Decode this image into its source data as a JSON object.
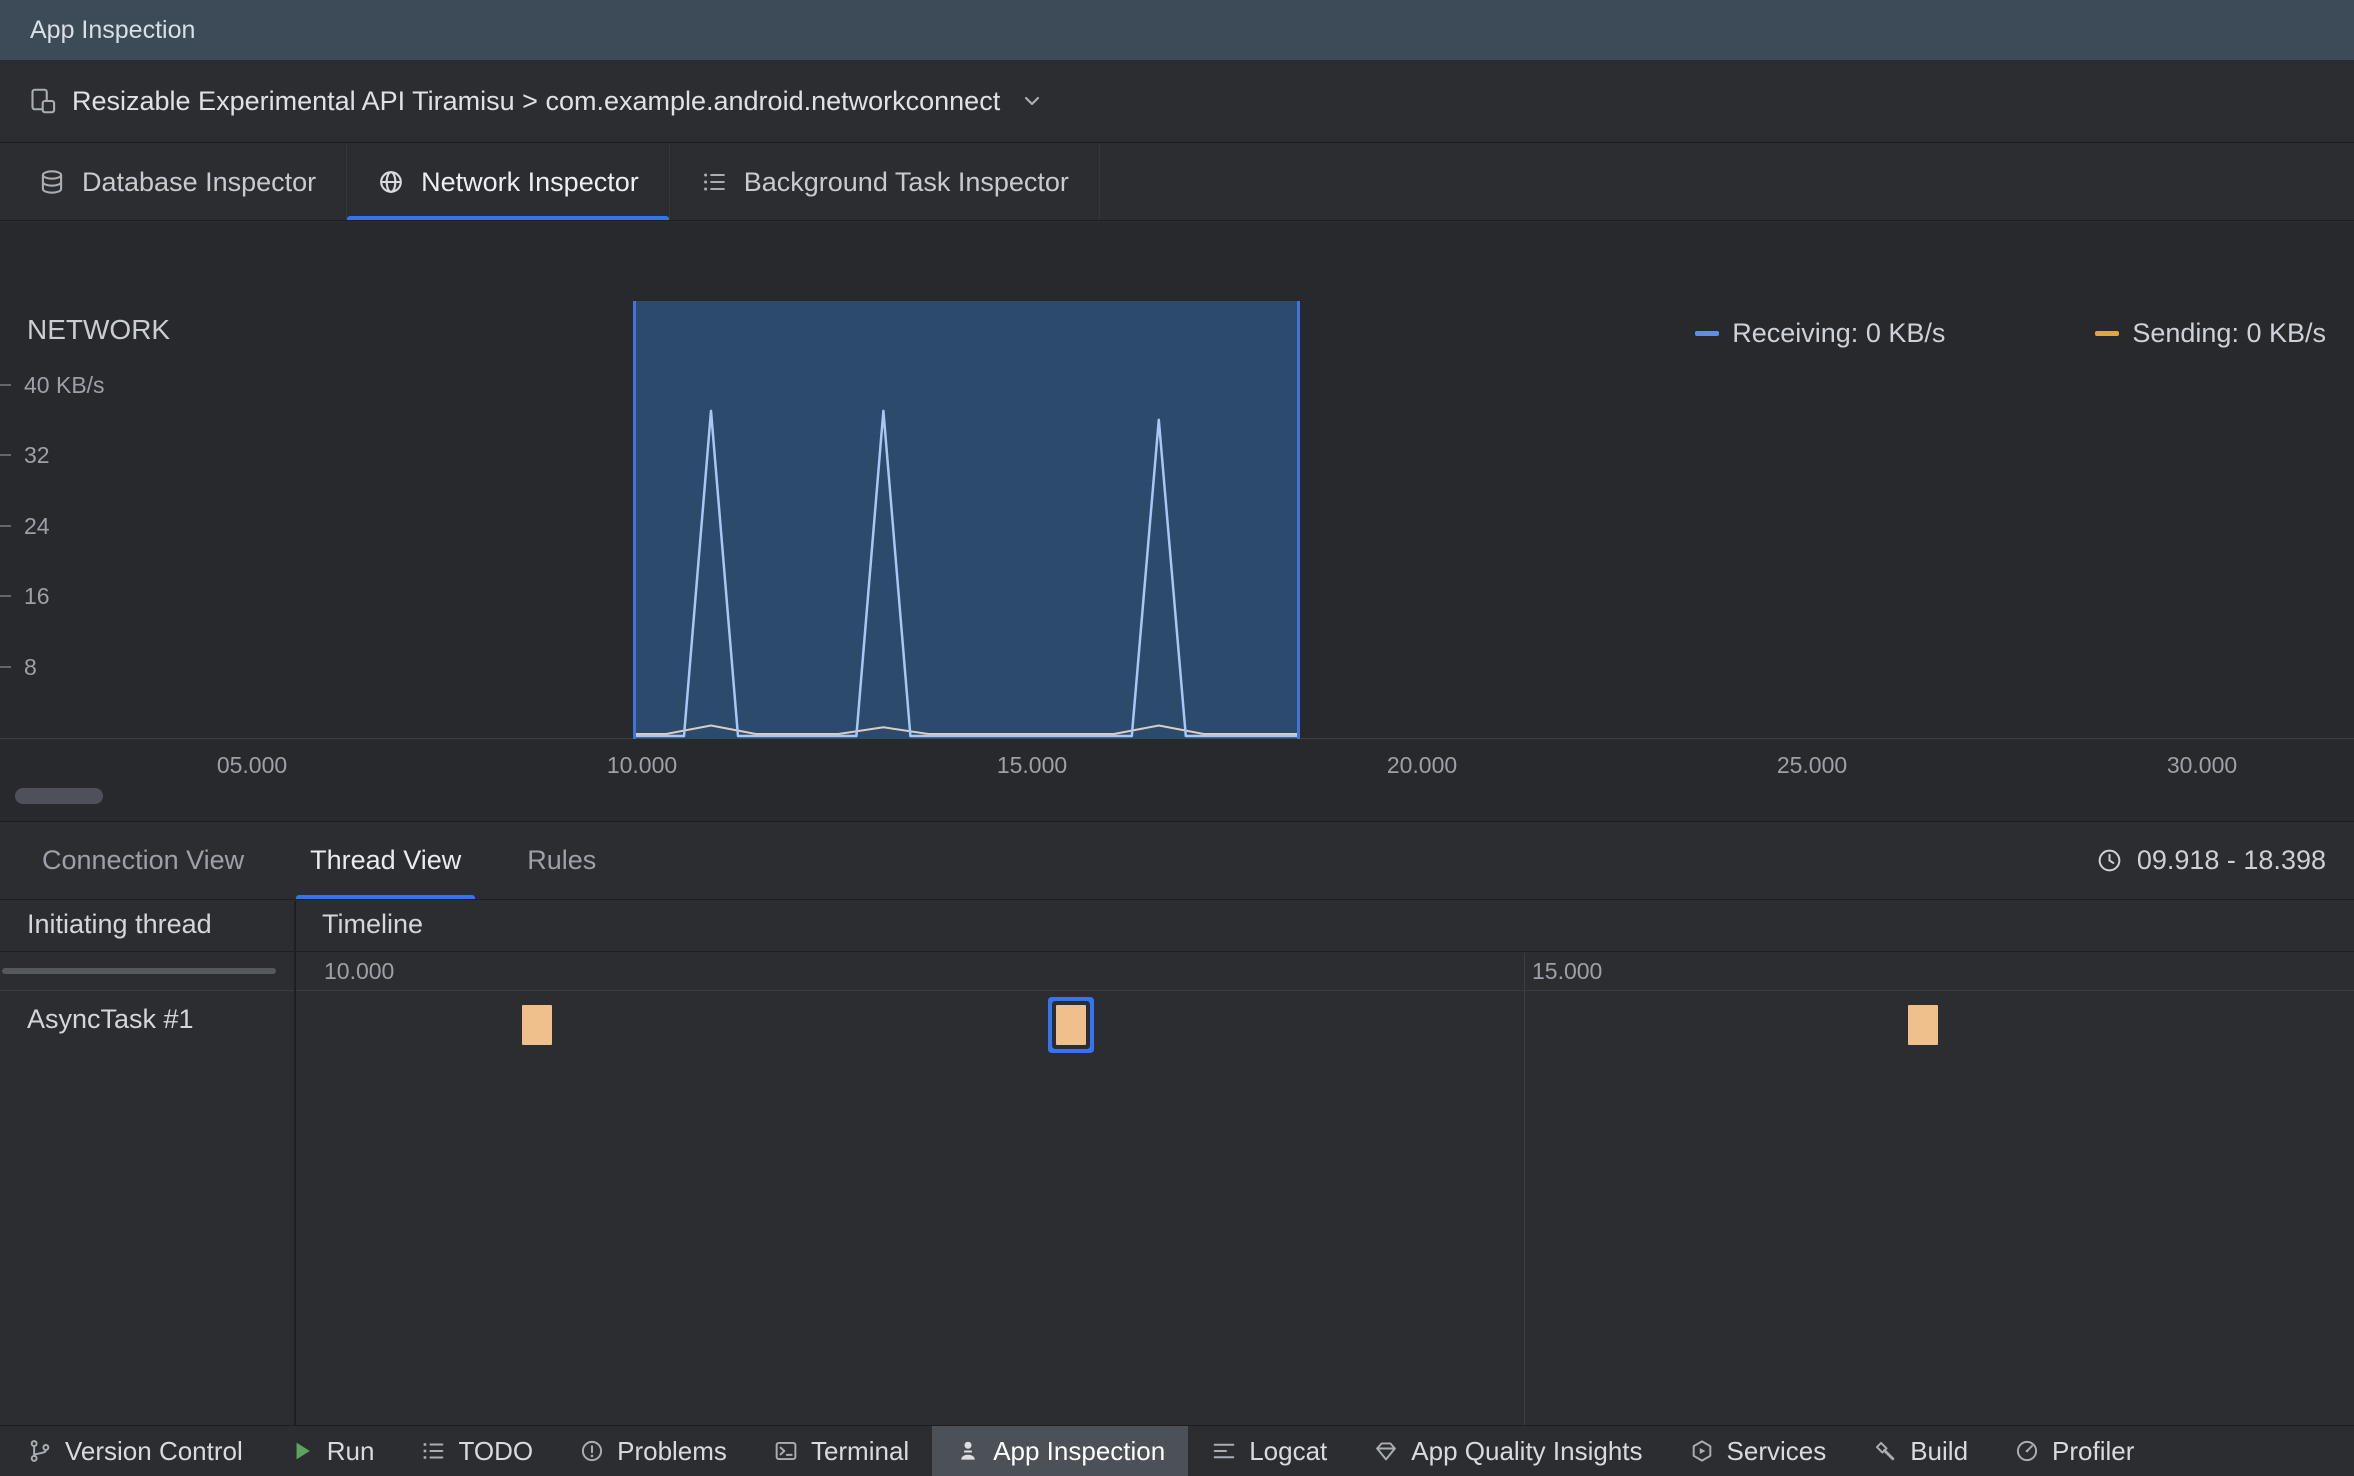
{
  "titlebar": {
    "title": "App Inspection"
  },
  "device_bar": {
    "label": "Resizable Experimental API Tiramisu > com.example.android.networkconnect"
  },
  "inspector_tabs": [
    {
      "label": "Database Inspector",
      "icon": "database-icon",
      "selected": false
    },
    {
      "label": "Network Inspector",
      "icon": "globe-icon",
      "selected": true
    },
    {
      "label": "Background Task Inspector",
      "icon": "list-icon",
      "selected": false
    }
  ],
  "chart_data": {
    "type": "area",
    "title": "NETWORK",
    "y_axis": {
      "unit": "KB/s",
      "ticks": [
        "40 KB/s",
        "32",
        "24",
        "16",
        "8"
      ],
      "tick_values": [
        40,
        32,
        24,
        16,
        8
      ],
      "range": [
        0,
        48
      ]
    },
    "x_axis": {
      "unit": "s",
      "ticks": [
        "05.000",
        "10.000",
        "15.000",
        "20.000",
        "25.000",
        "30.000"
      ],
      "tick_values": [
        5,
        10,
        15,
        20,
        25,
        30
      ]
    },
    "legend": [
      {
        "label": "Receiving: 0 KB/s",
        "color": "#5E8FE8"
      },
      {
        "label": "Sending: 0 KB/s",
        "color": "#E8A33D"
      }
    ],
    "selection": {
      "start_s": 9.918,
      "end_s": 18.398
    },
    "series": [
      {
        "name": "Receiving",
        "color": "#A9C7F2",
        "peaks": [
          {
            "t": 10.88,
            "value": 37
          },
          {
            "t": 13.09,
            "value": 37
          },
          {
            "t": 16.62,
            "value": 36
          }
        ]
      },
      {
        "name": "Sending",
        "color": "#D8CFC2",
        "peaks": [
          {
            "t": 10.88,
            "value": 1.3
          },
          {
            "t": 13.09,
            "value": 1.1
          },
          {
            "t": 16.62,
            "value": 1.3
          }
        ]
      }
    ]
  },
  "detail_tabs": [
    {
      "label": "Connection View",
      "selected": false
    },
    {
      "label": "Thread View",
      "selected": true
    },
    {
      "label": "Rules",
      "selected": false
    }
  ],
  "time_range": {
    "icon": "clock-icon",
    "label": "09.918 - 18.398"
  },
  "thread_table": {
    "columns": [
      "Initiating thread",
      "Timeline"
    ],
    "ticks": [
      {
        "label": "10.000",
        "t": 10,
        "grid": false
      },
      {
        "label": "15.000",
        "t": 15,
        "grid": true
      }
    ],
    "rows": [
      {
        "thread": "AsyncTask #1",
        "events": [
          {
            "t": 10.88,
            "selected": false
          },
          {
            "t": 13.09,
            "selected": true
          },
          {
            "t": 16.62,
            "selected": false
          }
        ]
      }
    ]
  },
  "bottom_bar": [
    {
      "label": "Version Control",
      "icon": "version-control-icon",
      "selected": false
    },
    {
      "label": "Run",
      "icon": "run-icon",
      "selected": false
    },
    {
      "label": "TODO",
      "icon": "todo-icon",
      "selected": false
    },
    {
      "label": "Problems",
      "icon": "problems-icon",
      "selected": false
    },
    {
      "label": "Terminal",
      "icon": "terminal-icon",
      "selected": false
    },
    {
      "label": "App Inspection",
      "icon": "app-inspection-icon",
      "selected": true
    },
    {
      "label": "Logcat",
      "icon": "logcat-icon",
      "selected": false
    },
    {
      "label": "App Quality Insights",
      "icon": "app-quality-insights-icon",
      "selected": false
    },
    {
      "label": "Services",
      "icon": "services-icon",
      "selected": false
    },
    {
      "label": "Build",
      "icon": "build-icon",
      "selected": false
    },
    {
      "label": "Profiler",
      "icon": "profiler-icon",
      "selected": false
    }
  ],
  "colors": {
    "accent_blue": "#3574F0",
    "selection_fill": "#2C4A6B",
    "selection_edge": "#3E74DC",
    "event_block": "#F0C08C",
    "run_green": "#5BA35F",
    "titlebar_bg": "#3D4A58",
    "panel_bg": "#2B2D30",
    "chart_bg": "#28292C"
  }
}
